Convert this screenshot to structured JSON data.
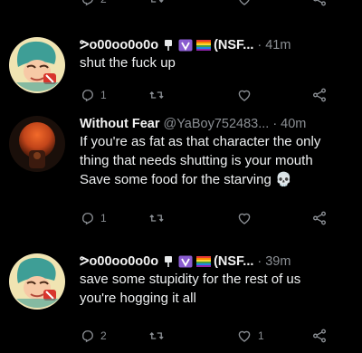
{
  "tweets": [
    {
      "display_name": "ᕗo00oo0o0o",
      "suffix": "(NSF...",
      "handle": "",
      "dot": "·",
      "time": "41m",
      "lines": [
        "shut the fuck up"
      ],
      "counts": {
        "reply": "1",
        "retweet": "",
        "like": "",
        "share": ""
      }
    },
    {
      "display_name": "Without Fear",
      "suffix": "",
      "handle": "@YaBoy752483...",
      "dot": "·",
      "time": "40m",
      "lines": [
        "If you're as fat as that character the only",
        "thing that needs shutting is your mouth",
        "Save some food for the starving 💀"
      ],
      "counts": {
        "reply": "1",
        "retweet": "",
        "like": "",
        "share": ""
      }
    },
    {
      "display_name": "ᕗo00oo0o0o",
      "suffix": "(NSF...",
      "handle": "",
      "dot": "·",
      "time": "39m",
      "lines": [
        "save some stupidity for the rest of us",
        "you're hogging it all"
      ],
      "counts": {
        "reply": "2",
        "retweet": "",
        "like": "1",
        "share": ""
      }
    }
  ],
  "top_counts": {
    "reply": "2"
  },
  "colors": {
    "background": "#000000",
    "text": "#e7e9ea",
    "muted": "#8b8f94",
    "verified_badge": "#8a5cd0"
  },
  "icons": [
    "reply-icon",
    "retweet-icon",
    "like-icon",
    "share-icon",
    "purple-badge-icon",
    "rainbow-flag-icon",
    "skull-emoji"
  ]
}
